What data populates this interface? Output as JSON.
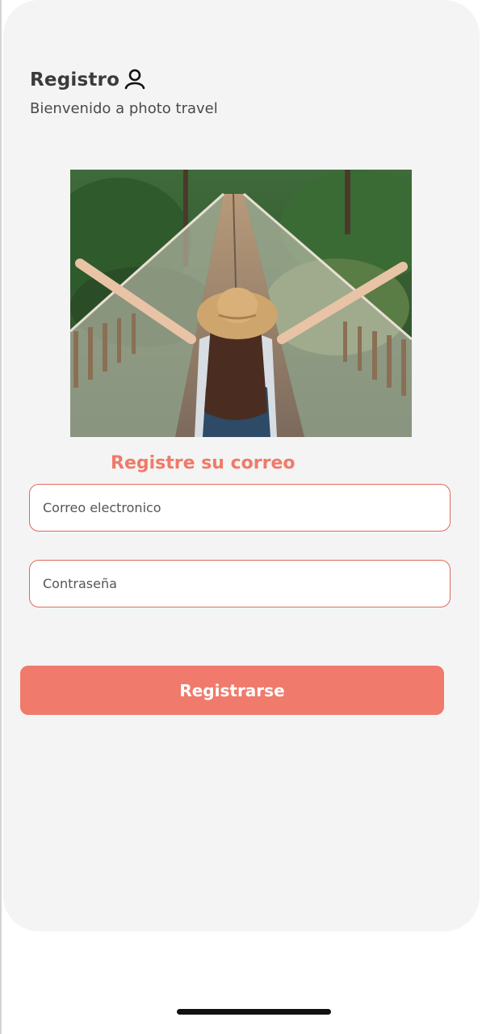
{
  "header": {
    "title": "Registro",
    "subtitle": "Bienvenido a photo travel",
    "icon": "user-icon"
  },
  "hero": {
    "image_description": "woman with straw hat on suspension bridge in forest"
  },
  "form": {
    "section_label": "Registre su correo",
    "email_placeholder": "Correo electronico",
    "email_value": "",
    "password_placeholder": "Contraseña",
    "password_value": "",
    "submit_label": "Registrarse"
  },
  "colors": {
    "accent": "#f07a6b",
    "field_border": "#e06a5c",
    "card_background": "#f4f4f4"
  }
}
